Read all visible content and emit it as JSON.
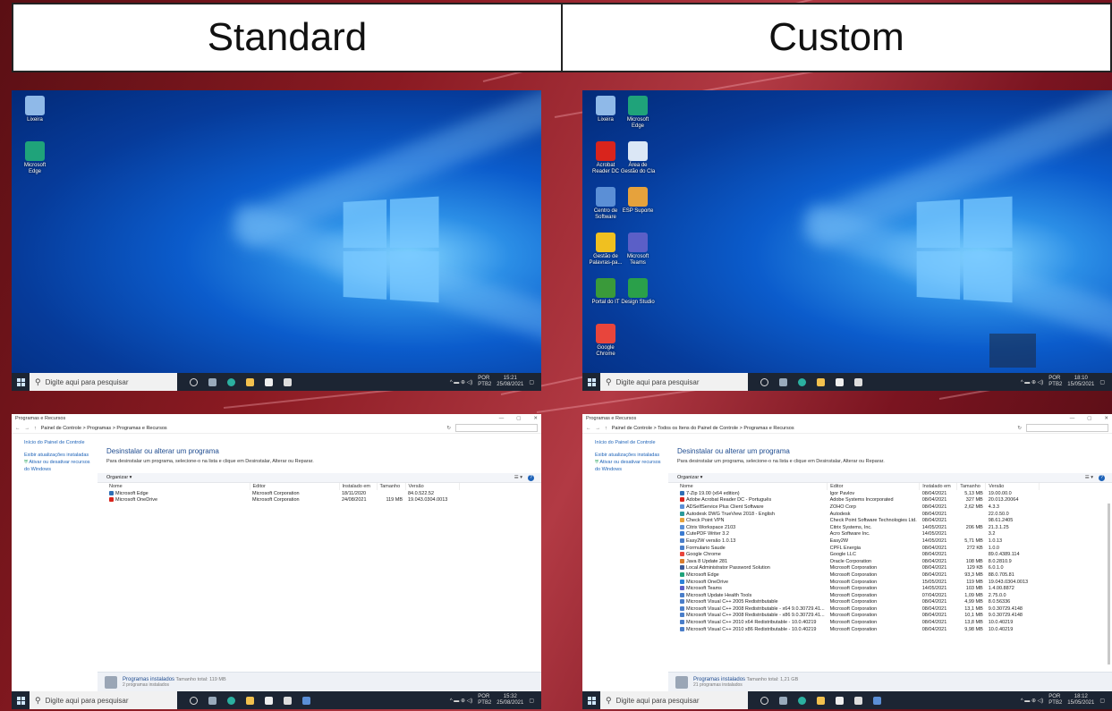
{
  "headers": [
    "Standard",
    "Custom"
  ],
  "taskbar": {
    "search_placeholder": "Digite aqui para pesquisar",
    "lang": "POR\nPTB2"
  },
  "standard_desktop": {
    "icons": [
      {
        "label": "Lixeira",
        "color": "#8fb9e8"
      },
      {
        "label": "Microsoft Edge",
        "color": "#1fa37a"
      }
    ],
    "clock": {
      "time": "15:21",
      "date": "25/08/2021"
    }
  },
  "custom_desktop": {
    "icons": [
      {
        "label": "Lixeira",
        "color": "#8fb9e8"
      },
      {
        "label": "Microsoft Edge",
        "color": "#1fa37a"
      },
      {
        "label": "Acrobat Reader DC",
        "color": "#d9241c"
      },
      {
        "label": "Área de Gestão do Cla",
        "color": "#dbe7f6"
      },
      {
        "label": "Centro de Software",
        "color": "#5b8fd6"
      },
      {
        "label": "ESP Suporte",
        "color": "#e6a23c"
      },
      {
        "label": "Gestão de Palavras-pa...",
        "color": "#f0c020"
      },
      {
        "label": "Microsoft Teams",
        "color": "#5b5fc7"
      },
      {
        "label": "Portal do IT",
        "color": "#3a9a3a"
      },
      {
        "label": "Design Studio",
        "color": "#2aa04a"
      },
      {
        "label": "Google Chrome",
        "color": "#e8453c"
      }
    ],
    "clock": {
      "time": "18:10",
      "date": "15/05/2021"
    }
  },
  "control_panel_standard": {
    "title": "Programas e Recursos",
    "path": "Painel de Controle  >  Programas  >  Programas e Recursos",
    "sidebar": [
      "Início do Painel de Controle",
      "Exibir atualizações instaladas",
      "Ativar ou desativar recursos do Windows"
    ],
    "heading": "Desinstalar ou alterar um programa",
    "subtext": "Para desinstalar um programa, selecione-o na lista e clique em Desinstalar, Alterar ou Reparar.",
    "organize": "Organizar ▾",
    "columns": [
      "Nome",
      "Editor",
      "Instalado em",
      "Tamanho",
      "Versão"
    ],
    "rows": [
      [
        "Microsoft Edge",
        "Microsoft Corporation",
        "18/11/2020",
        "",
        "84.0.522.52"
      ],
      [
        "Microsoft OneDrive",
        "Microsoft Corporation",
        "24/08/2021",
        "119 MB",
        "19.043.0304.0013"
      ]
    ],
    "footer_title": "Programas instalados",
    "footer_total": "Tamanho total:  119 MB",
    "footer_count": "2 programas instalados",
    "clock": {
      "time": "15:32",
      "date": "25/08/2021"
    }
  },
  "control_panel_custom": {
    "title": "Programas e Recursos",
    "path": "Painel de Controle  >  Todos os Itens do Painel de Controle  >  Programas e Recursos",
    "sidebar": [
      "Início do Painel de Controle",
      "Exibir atualizações instaladas",
      "Ativar ou desativar recursos do Windows"
    ],
    "heading": "Desinstalar ou alterar um programa",
    "subtext": "Para desinstalar um programa, selecione-o na lista e clique em Desinstalar, Alterar ou Reparar.",
    "organize": "Organizar ▾",
    "columns": [
      "Nome",
      "Editor",
      "Instalado em",
      "Tamanho",
      "Versão"
    ],
    "rows": [
      [
        "7-Zip 19.00 (x64 edition)",
        "Igor Pavlov",
        "08/04/2021",
        "5,13 MB",
        "19.00.00.0"
      ],
      [
        "Adobe Acrobat Reader DC - Português",
        "Adobe Systems Incorporated",
        "08/04/2021",
        "327 MB",
        "20.013.20064"
      ],
      [
        "ADSelfService Plus Client Software",
        "ZOHO Corp",
        "08/04/2021",
        "2,62 MB",
        "4.3.3"
      ],
      [
        "Autodesk DWG TrueView 2018 - English",
        "Autodesk",
        "08/04/2021",
        "",
        "22.0.50.0"
      ],
      [
        "Check Point VPN",
        "Check Point Software Technologies Ltd.",
        "08/04/2021",
        "",
        "98.61.2405"
      ],
      [
        "Citrix Workspace 2103",
        "Citrix Systems, Inc.",
        "14/05/2021",
        "206 MB",
        "21.3.1.25"
      ],
      [
        "CutePDF Writer 3.2",
        "Acro Software Inc.",
        "14/05/2021",
        "",
        "3.2"
      ],
      [
        "Easy2W versão 1.0.13",
        "Easy2W",
        "14/05/2021",
        "5,71 MB",
        "1.0.13"
      ],
      [
        "Formulario Saude",
        "CPFL Energia",
        "08/04/2021",
        "272 KB",
        "1.0.0"
      ],
      [
        "Google Chrome",
        "Google LLC",
        "08/04/2021",
        "",
        "89.0.4389.114"
      ],
      [
        "Java 8 Update 281",
        "Oracle Corporation",
        "08/04/2021",
        "108 MB",
        "8.0.2810.9"
      ],
      [
        "Local Administrator Password Solution",
        "Microsoft Corporation",
        "08/04/2021",
        "129 KB",
        "6.0.1.0"
      ],
      [
        "Microsoft Edge",
        "Microsoft Corporation",
        "08/04/2021",
        "93,3 MB",
        "88.0.705.81"
      ],
      [
        "Microsoft OneDrive",
        "Microsoft Corporation",
        "15/05/2021",
        "119 MB",
        "19.043.0304.0013"
      ],
      [
        "Microsoft Teams",
        "Microsoft Corporation",
        "14/05/2021",
        "103 MB",
        "1.4.00.8872"
      ],
      [
        "Microsoft Update Health Tools",
        "Microsoft Corporation",
        "07/04/2021",
        "1,09 MB",
        "2.75.0.0"
      ],
      [
        "Microsoft Visual C++ 2005 Redistributable",
        "Microsoft Corporation",
        "08/04/2021",
        "4,99 MB",
        "8.0.56336"
      ],
      [
        "Microsoft Visual C++ 2008 Redistributable - x64 9.0.30729.41...",
        "Microsoft Corporation",
        "08/04/2021",
        "13,1 MB",
        "9.0.30729.4148"
      ],
      [
        "Microsoft Visual C++ 2008 Redistributable - x86 9.0.30729.41...",
        "Microsoft Corporation",
        "08/04/2021",
        "10,1 MB",
        "9.0.30729.4148"
      ],
      [
        "Microsoft Visual C++ 2010  x64 Redistributable - 10.0.40219",
        "Microsoft Corporation",
        "08/04/2021",
        "13,8 MB",
        "10.0.40219"
      ],
      [
        "Microsoft Visual C++ 2010  x86 Redistributable - 10.0.40219",
        "Microsoft Corporation",
        "08/04/2021",
        "9,98 MB",
        "10.0.40219"
      ]
    ],
    "footer_title": "Programas instalados",
    "footer_total": "Tamanho total:  1,21 GB",
    "footer_count": "21 programas instalados",
    "clock": {
      "time": "18:12",
      "date": "15/05/2021"
    }
  }
}
